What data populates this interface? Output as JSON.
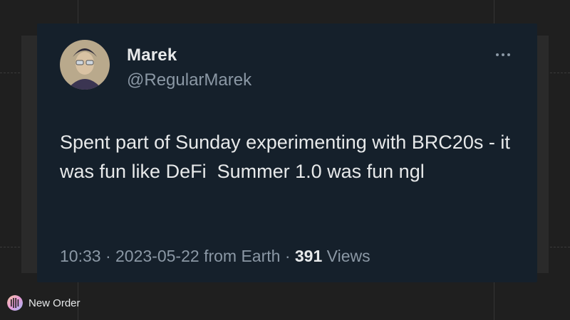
{
  "tweet": {
    "display_name": "Marek",
    "handle": "@RegularMarek",
    "text": "Spent part of Sunday experimenting with BRC20s - it was fun like DeFi  Summer 1.0 was fun ngl",
    "time": "10:33",
    "date": "2023-05-22",
    "source": "from Earth",
    "views_count": "391",
    "views_label": "Views",
    "more_icon": "more-horizontal-icon"
  },
  "branding": {
    "label": "New Order",
    "logo_icon": "new-order-logo-icon"
  },
  "colors": {
    "card_background": "#15202b",
    "page_background": "#1f1f1f",
    "primary_text": "#e7e9ea",
    "secondary_text": "#8b98a5"
  }
}
